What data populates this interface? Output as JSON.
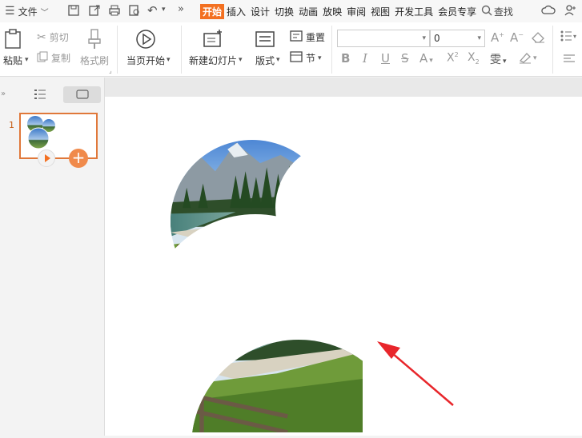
{
  "menubar": {
    "file": "文件",
    "tabs": [
      "开始",
      "插入",
      "设计",
      "切换",
      "动画",
      "放映",
      "审阅",
      "视图",
      "开发工具",
      "会员专享"
    ],
    "search": "查找"
  },
  "ribbon": {
    "paste": "粘贴",
    "cut": "剪切",
    "copy": "复制",
    "format_painter": "格式刷",
    "from_current": "当页开始",
    "new_slide": "新建幻灯片",
    "layout": "版式",
    "reset": "重置",
    "section": "节",
    "font_size": "0"
  },
  "panel": {
    "slide_number": "1"
  },
  "colors": {
    "accent": "#f37021",
    "arrow": "#e8262b"
  }
}
